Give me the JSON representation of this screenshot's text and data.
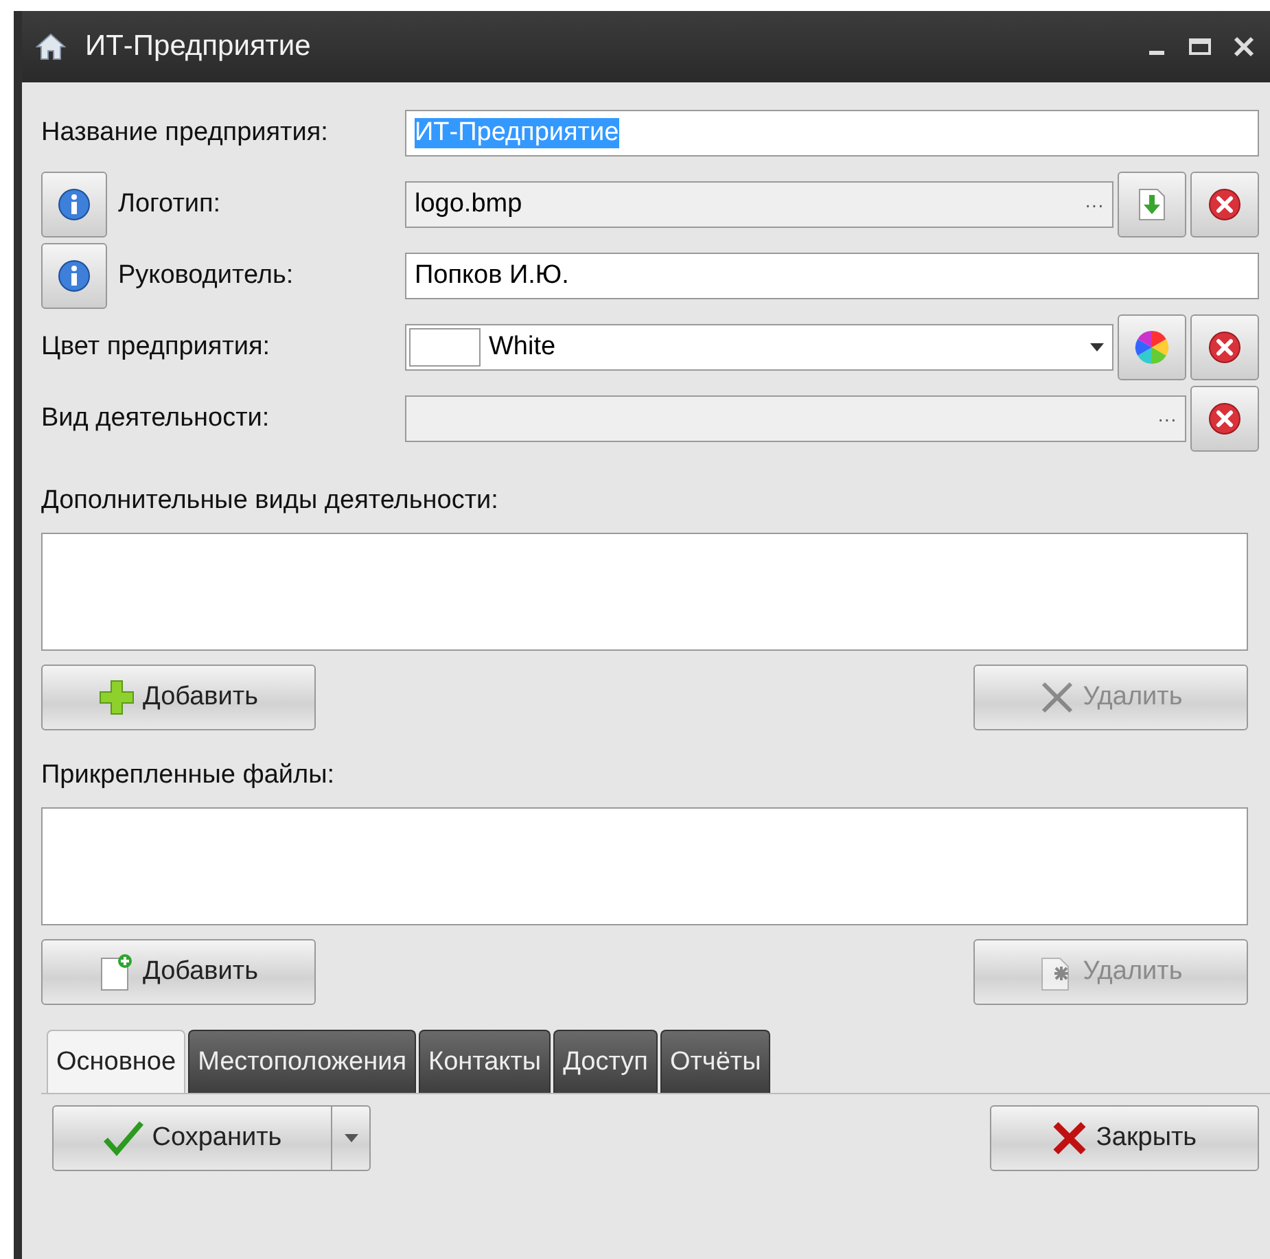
{
  "window": {
    "title": "ИТ-Предприятие"
  },
  "fields": [
    {
      "kind": "text",
      "label": "Название предприятия:",
      "value": "ИТ-Предприятие",
      "text_selected": true,
      "readonly": false
    },
    {
      "kind": "file",
      "label": "Логотип:",
      "info": true,
      "value": "logo.bmp",
      "readonly": true,
      "ellipsis": "···"
    },
    {
      "kind": "text",
      "label": "Руководитель:",
      "info": true,
      "value": "Попков И.Ю.",
      "text_selected": false,
      "readonly": false
    },
    {
      "kind": "color",
      "label": "Цвет предприятия:",
      "value": "White",
      "readonly": false
    },
    {
      "kind": "picker",
      "label": "Вид деятельности:",
      "readonly": true,
      "ellipsis": "···"
    }
  ],
  "lists": [
    {
      "kind": "activities",
      "label": "Дополнительные виды деятельности:",
      "add_button": {
        "label": "Добавить",
        "disabled": false
      },
      "remove_button": {
        "label": "Удалить",
        "disabled": true
      }
    },
    {
      "kind": "files",
      "label": "Прикрепленные файлы:",
      "add_button": {
        "label": "Добавить",
        "disabled": false
      },
      "remove_button": {
        "label": "Удалить",
        "disabled": true
      }
    }
  ],
  "tabs": [
    {
      "label": "Основное",
      "selected": true
    },
    {
      "label": "Местоположения",
      "selected": false
    },
    {
      "label": "Контакты",
      "selected": false
    },
    {
      "label": "Доступ",
      "selected": false
    },
    {
      "label": "Отчёты",
      "selected": false
    }
  ],
  "footer": {
    "save_button": "Сохранить",
    "close_button": "Закрыть"
  }
}
